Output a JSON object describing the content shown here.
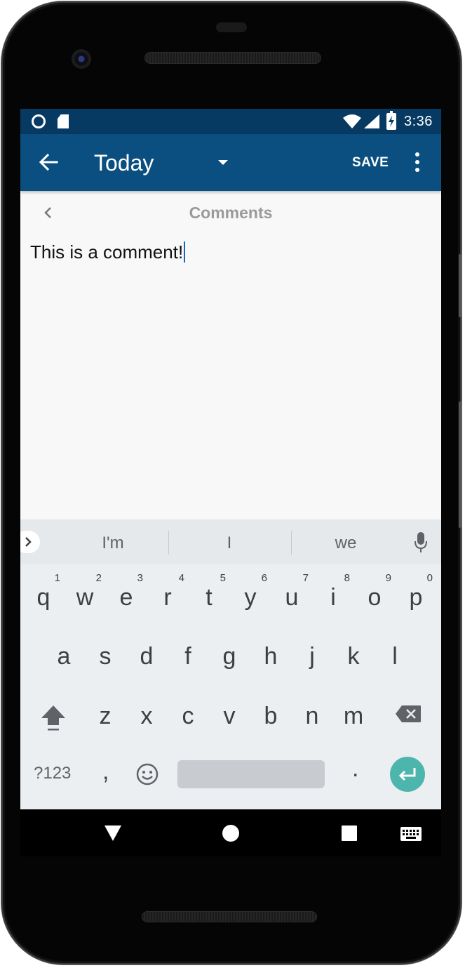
{
  "status_bar": {
    "time": "3:36",
    "icons": [
      "sync-circle-icon",
      "sd-card-icon",
      "wifi-icon",
      "cell-signal-icon",
      "battery-charging-icon"
    ]
  },
  "app_bar": {
    "title": "Today",
    "save_label": "SAVE",
    "color": "#0b4f80",
    "status_color": "#073a62"
  },
  "content": {
    "heading": "Comments",
    "comment_text": "This is a comment!"
  },
  "keyboard": {
    "suggestions": [
      "I'm",
      "I",
      "we"
    ],
    "row1": [
      {
        "k": "q",
        "n": "1"
      },
      {
        "k": "w",
        "n": "2"
      },
      {
        "k": "e",
        "n": "3"
      },
      {
        "k": "r",
        "n": "4"
      },
      {
        "k": "t",
        "n": "5"
      },
      {
        "k": "y",
        "n": "6"
      },
      {
        "k": "u",
        "n": "7"
      },
      {
        "k": "i",
        "n": "8"
      },
      {
        "k": "o",
        "n": "9"
      },
      {
        "k": "p",
        "n": "0"
      }
    ],
    "row2": [
      "a",
      "s",
      "d",
      "f",
      "g",
      "h",
      "j",
      "k",
      "l"
    ],
    "row3": [
      "z",
      "x",
      "c",
      "v",
      "b",
      "n",
      "m"
    ],
    "symbols_label": "?123",
    "comma": ",",
    "period": ".",
    "enter_color": "#4db6ac"
  }
}
